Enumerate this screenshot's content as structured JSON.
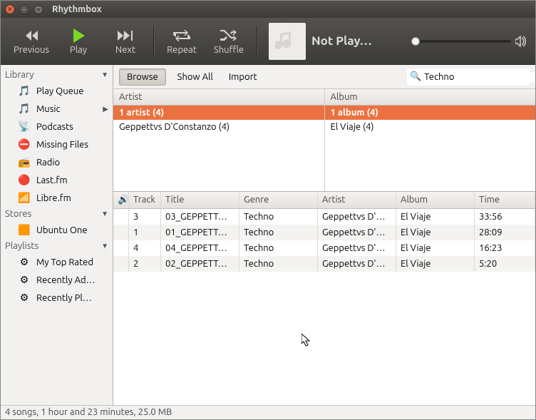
{
  "window": {
    "title": "Rhythmbox"
  },
  "toolbar": {
    "previous": "Previous",
    "play": "Play",
    "next": "Next",
    "repeat": "Repeat",
    "shuffle": "Shuffle"
  },
  "nowplaying": {
    "status": "Not Play…"
  },
  "sidebar": {
    "sections": [
      {
        "label": "Library",
        "items": [
          {
            "label": "Play Queue",
            "icon": "🎵"
          },
          {
            "label": "Music",
            "icon": "🎵",
            "expandable": true
          },
          {
            "label": "Podcasts",
            "icon": "📡"
          },
          {
            "label": "Missing Files",
            "icon": "⛔"
          },
          {
            "label": "Radio",
            "icon": "📻"
          },
          {
            "label": "Last.fm",
            "icon": "🔴"
          },
          {
            "label": "Libre.fm",
            "icon": "📶"
          }
        ]
      },
      {
        "label": "Stores",
        "items": [
          {
            "label": "Ubuntu One",
            "icon": "🟧"
          }
        ]
      },
      {
        "label": "Playlists",
        "items": [
          {
            "label": "My Top Rated",
            "icon": "⚙"
          },
          {
            "label": "Recently Ad…",
            "icon": "⚙"
          },
          {
            "label": "Recently Pl…",
            "icon": "⚙"
          }
        ]
      }
    ]
  },
  "actionbar": {
    "browse": "Browse",
    "showall": "Show All",
    "import": "Import",
    "search_value": "Techno"
  },
  "browser": {
    "artist_header": "Artist",
    "album_header": "Album",
    "artists": [
      {
        "label": "1 artist (4)",
        "selected": true
      },
      {
        "label": "Geppettvs D'Constanzo (4)",
        "selected": false
      }
    ],
    "albums": [
      {
        "label": "1 album (4)",
        "selected": true
      },
      {
        "label": "El Viaje (4)",
        "selected": false
      }
    ]
  },
  "tracks": {
    "headers": {
      "np": "🔊",
      "track": "Track",
      "title": "Title",
      "genre": "Genre",
      "artist": "Artist",
      "album": "Album",
      "time": "Time"
    },
    "rows": [
      {
        "track": "3",
        "title": "03_GEPPETT…",
        "genre": "Techno",
        "artist": "Geppettvs D'…",
        "album": "El Viaje",
        "time": "33:56"
      },
      {
        "track": "1",
        "title": "01_GEPPETT…",
        "genre": "Techno",
        "artist": "Geppettvs D'…",
        "album": "El Viaje",
        "time": "28:09"
      },
      {
        "track": "4",
        "title": "04_GEPPETT…",
        "genre": "Techno",
        "artist": "Geppettvs D'…",
        "album": "El Viaje",
        "time": "16:23"
      },
      {
        "track": "2",
        "title": "02_GEPPETT…",
        "genre": "Techno",
        "artist": "Geppettvs D'…",
        "album": "El Viaje",
        "time": "5:20"
      }
    ]
  },
  "statusbar": "4 songs, 1 hour and 23 minutes, 25.0 MB"
}
